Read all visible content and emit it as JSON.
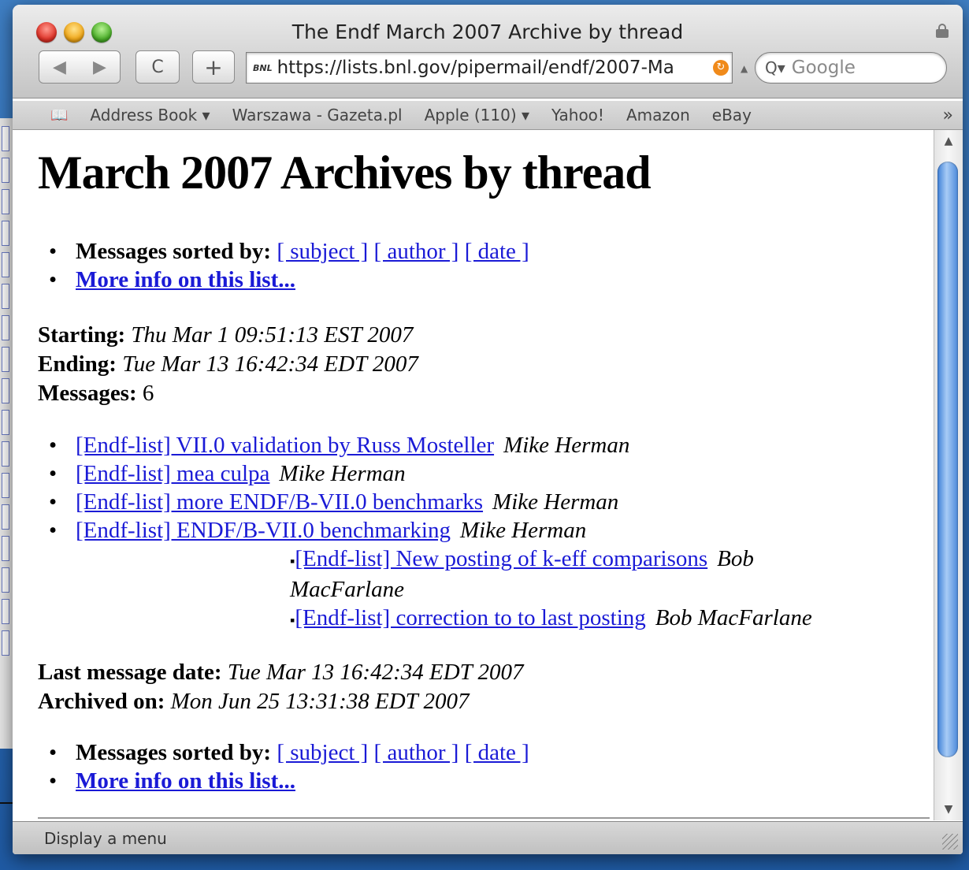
{
  "window": {
    "title": "The Endf March 2007 Archive by thread",
    "url": "https://lists.bnl.gov/pipermail/endf/2007-Ma",
    "url_favicon": "BNL",
    "search_placeholder": "Google",
    "status": "Display a menu"
  },
  "toolbar": {
    "back": "◀",
    "forward": "▶",
    "reload": "C",
    "add": "+"
  },
  "bookmarks": [
    "Address Book ▾",
    "Warszawa - Gazeta.pl",
    "Apple (110) ▾",
    "Yahoo!",
    "Amazon",
    "eBay"
  ],
  "bookmarks_more": "»",
  "page": {
    "heading": "March 2007 Archives by thread",
    "sorted_label": "Messages sorted by:",
    "sort_links": [
      "[ subject ]",
      "[ author ]",
      "[ date ]"
    ],
    "more_info": "More info on this list...",
    "starting_label": "Starting:",
    "starting_value": "Thu Mar 1 09:51:13 EST 2007",
    "ending_label": "Ending:",
    "ending_value": "Tue Mar 13 16:42:34 EDT 2007",
    "messages_label": "Messages:",
    "messages_value": "6",
    "threads": [
      {
        "subject": "[Endf-list] VII.0 validation by Russ Mosteller",
        "author": "Mike Herman"
      },
      {
        "subject": "[Endf-list] mea culpa",
        "author": "Mike Herman"
      },
      {
        "subject": "[Endf-list] more ENDF/B-VII.0 benchmarks",
        "author": "Mike Herman"
      },
      {
        "subject": "[Endf-list] ENDF/B-VII.0 benchmarking",
        "author": "Mike Herman"
      }
    ],
    "replies": [
      {
        "subject": "[Endf-list] New posting of k-eff comparisons",
        "author_a": "Bob",
        "author_b": "MacFarlane"
      },
      {
        "subject": "[Endf-list] correction to to last posting",
        "author": "Bob MacFarlane"
      }
    ],
    "last_date_label": "Last message date:",
    "last_date_value": "Tue Mar 13 16:42:34 EDT 2007",
    "archived_label": "Archived on:",
    "archived_value": "Mon Jun 25 13:31:38 EDT 2007"
  },
  "colors": {
    "link": "#1a1ad6",
    "scroll_thumb": "#3d7fd6",
    "desktop": "#2e6db5"
  }
}
